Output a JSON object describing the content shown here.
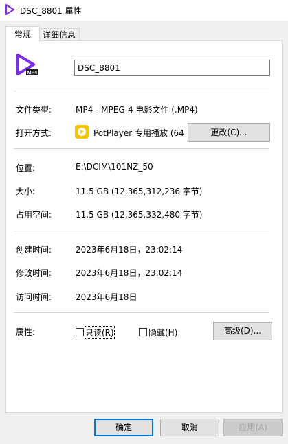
{
  "window": {
    "title": "DSC_8801 属性"
  },
  "tabs": [
    {
      "label": "常规"
    },
    {
      "label": "详细信息"
    }
  ],
  "file": {
    "name": "DSC_8801",
    "icon_badge": "MP4"
  },
  "type_row": {
    "label": "文件类型:",
    "value": "MP4 - MPEG-4 电影文件 (.MP4)"
  },
  "opens_with": {
    "label": "打开方式:",
    "value": "PotPlayer 专用播放 (64",
    "change_button": "更改(C)..."
  },
  "location": {
    "label": "位置:",
    "value": "E:\\DCIM\\101NZ_50"
  },
  "size": {
    "label": "大小:",
    "value": "11.5 GB (12,365,312,236 字节)"
  },
  "size_on_disk": {
    "label": "占用空间:",
    "value": "11.5 GB (12,365,332,480 字节)"
  },
  "created": {
    "label": "创建时间:",
    "value": "2023年6月18日，23:02:14"
  },
  "modified": {
    "label": "修改时间:",
    "value": "2023年6月18日，23:02:14"
  },
  "accessed": {
    "label": "访问时间:",
    "value": "2023年6月18日"
  },
  "attributes": {
    "label": "属性:",
    "readonly_label": "只读(R)",
    "hidden_label": "隐藏(H)",
    "advanced_button": "高级(D)..."
  },
  "footer": {
    "ok": "确定",
    "cancel": "取消",
    "apply": "应用(A)"
  },
  "colors": {
    "accent": "#7b2cf0",
    "focus": "#0078d7",
    "app_icon": "#f5c400"
  }
}
